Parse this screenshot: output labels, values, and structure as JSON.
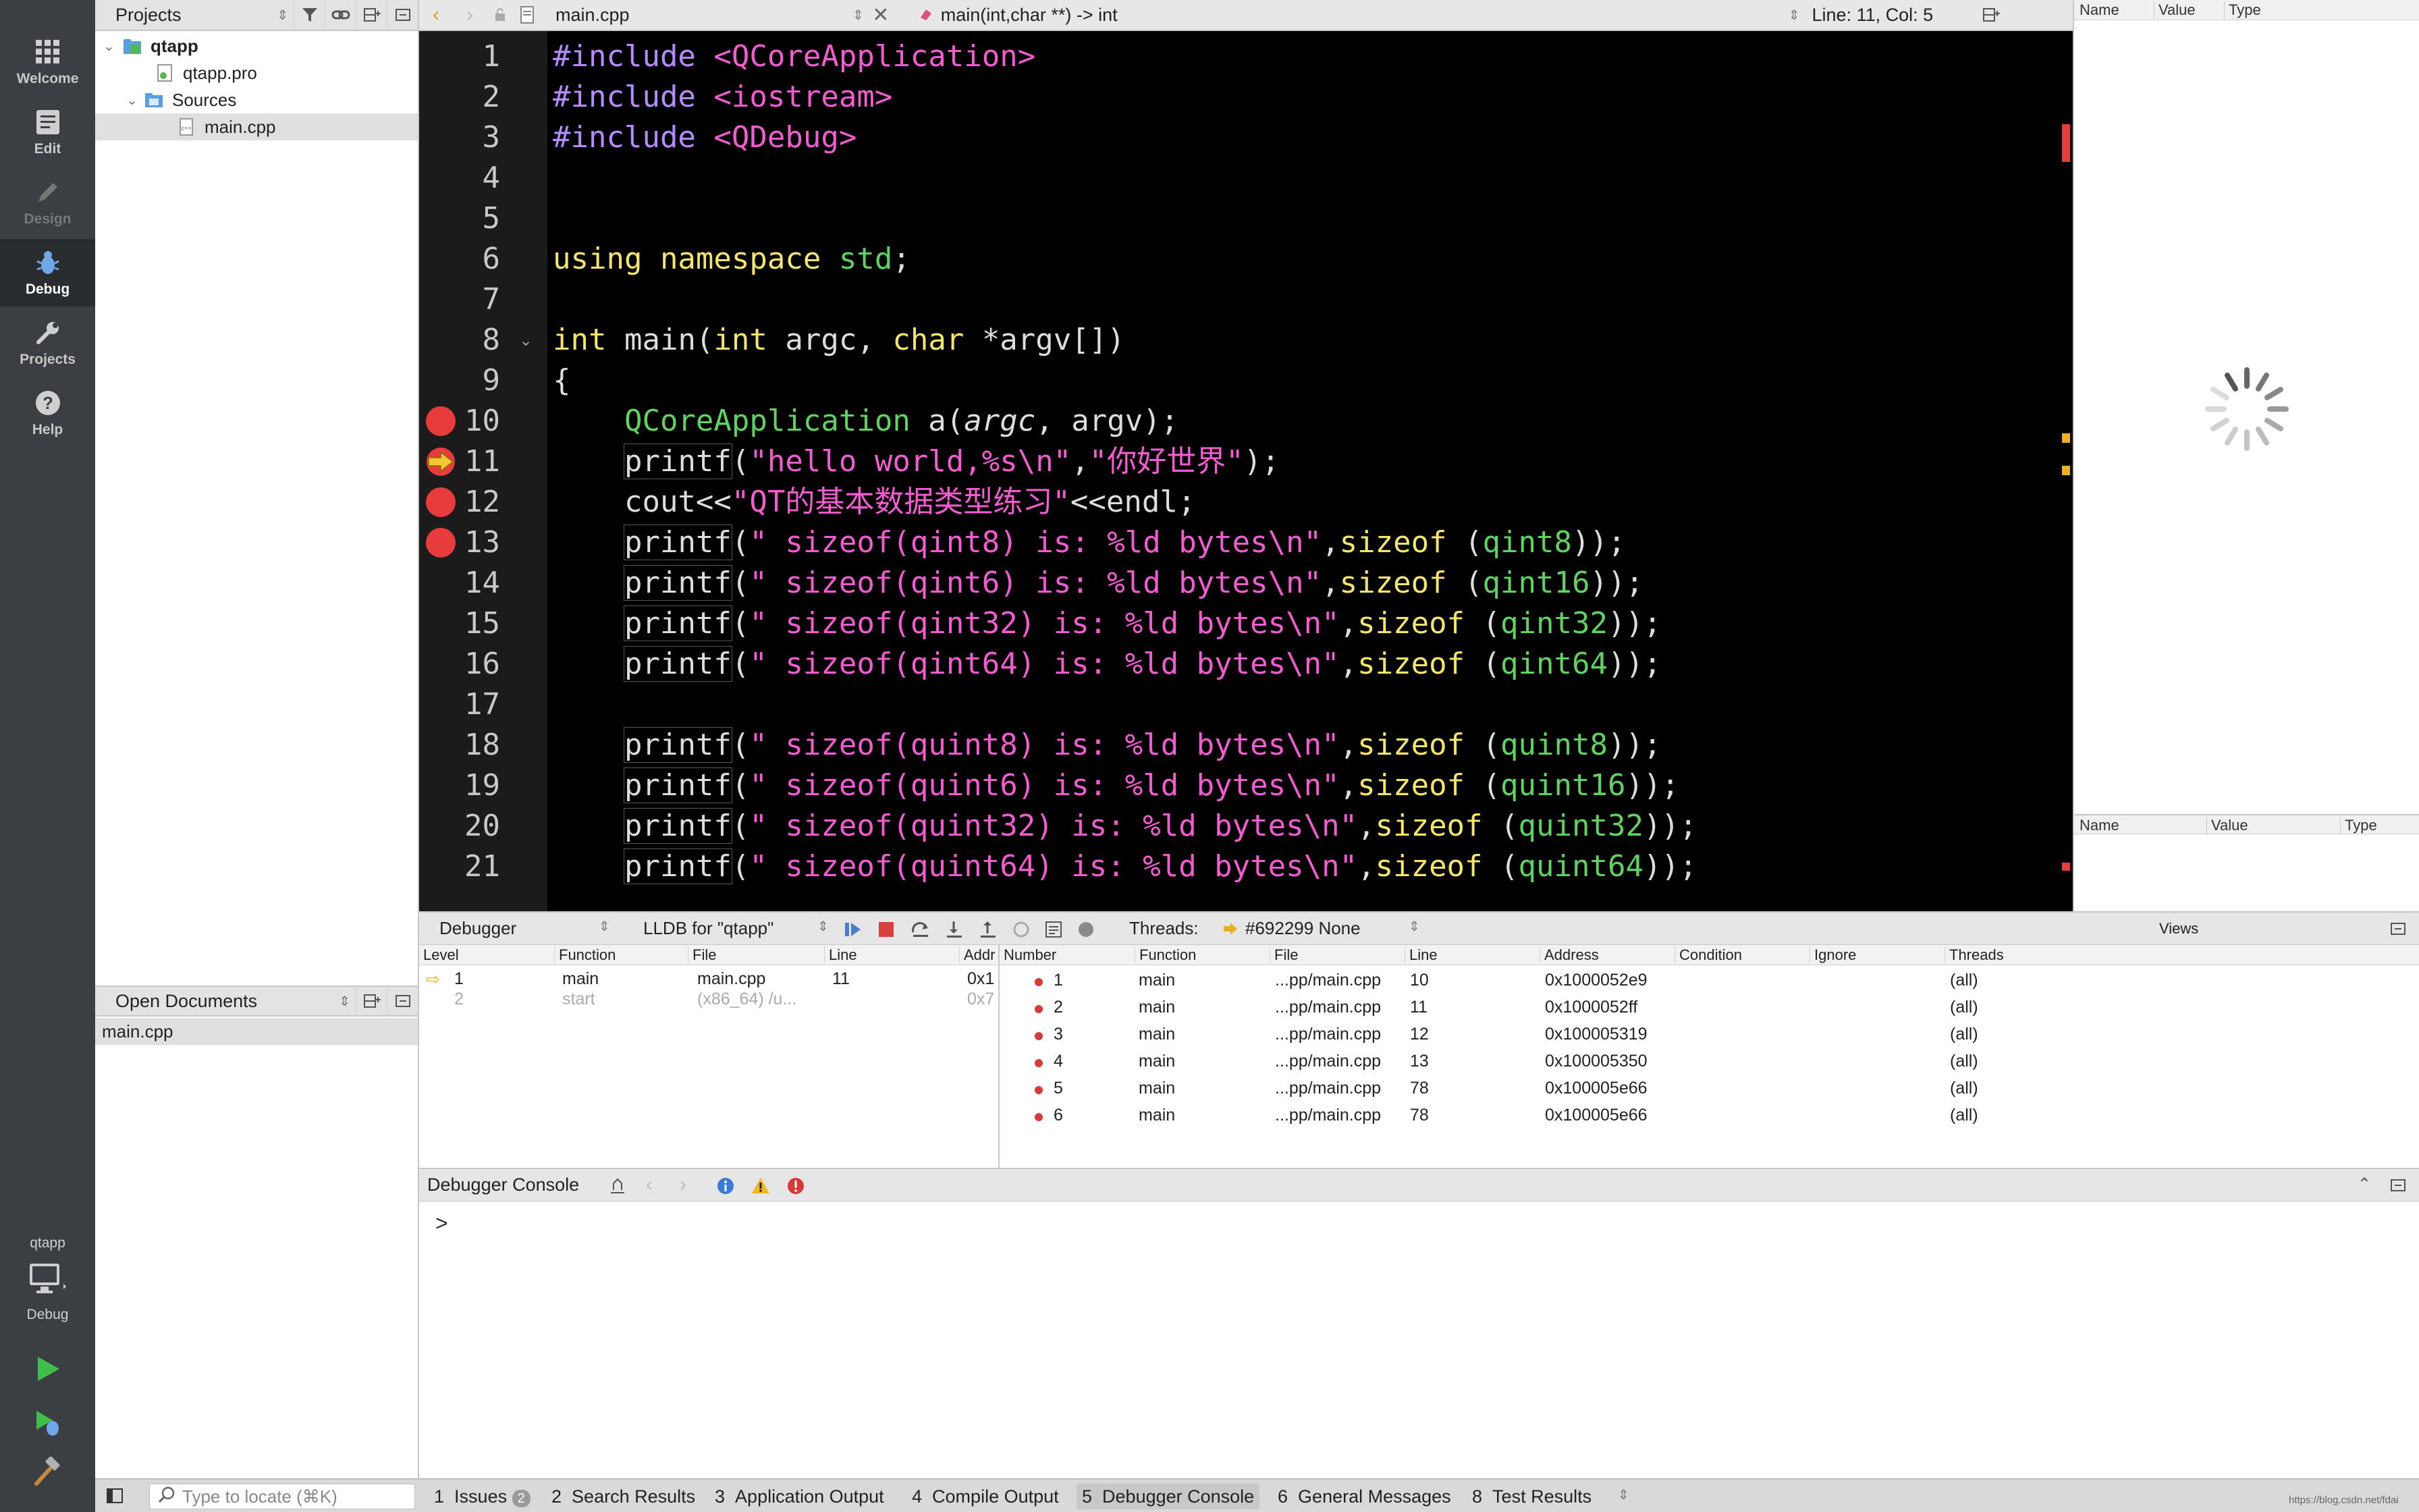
{
  "modes": [
    {
      "label": "Welcome",
      "icon": "grid-icon"
    },
    {
      "label": "Edit",
      "icon": "edit-icon"
    },
    {
      "label": "Design",
      "icon": "pencil-icon"
    },
    {
      "label": "Debug",
      "icon": "bug-icon"
    },
    {
      "label": "Projects",
      "icon": "wrench-icon"
    },
    {
      "label": "Help",
      "icon": "help-icon"
    }
  ],
  "kit": {
    "project": "qtapp",
    "build": "Debug"
  },
  "projects_panel": {
    "title": "Projects",
    "tree": {
      "project": "qtapp",
      "pro": "qtapp.pro",
      "sources": "Sources",
      "file": "main.cpp"
    }
  },
  "open_documents": {
    "title": "Open Documents",
    "items": [
      "main.cpp"
    ]
  },
  "editor_toolbar": {
    "file": "main.cpp",
    "symbol": "main(int,char **) -> int",
    "position": "Line: 11, Col: 5"
  },
  "code": {
    "line_numbers": [
      "1",
      "2",
      "3",
      "4",
      "5",
      "6",
      "7",
      "8",
      "9",
      "10",
      "11",
      "12",
      "13",
      "14",
      "15",
      "16",
      "17",
      "18",
      "19",
      "20",
      "21"
    ],
    "breakpoint_lines": [
      10,
      12,
      13
    ],
    "current_line": 11,
    "lines": {
      "l1a": "#include",
      "l1b": " <QCoreApplication>",
      "l2a": "#include",
      "l2b": " <iostream>",
      "l3a": "#include",
      "l3b": " <QDebug>",
      "l6a": "using namespace",
      "l6b": " std",
      "l6c": ";",
      "l8a": "int",
      "l8b": " main(",
      "l8c": "int",
      "l8d": " argc, ",
      "l8e": "char",
      "l8f": " *argv[])",
      "l9": "{",
      "l10a": "    ",
      "l10b": "QCoreApplication",
      "l10c": " a(",
      "l10d": "argc",
      "l10e": ", argv);",
      "l11a": "    ",
      "l11b": "printf",
      "l11c": "(",
      "l11d": "\"hello world,%s\\n\"",
      "l11e": ",",
      "l11f": "\"你好世界\"",
      "l11g": ");",
      "l12a": "    cout<<",
      "l12b": "\"QT的基本数据类型练习\"",
      "l12c": "<<endl;",
      "l13a": "    ",
      "l13b": "printf",
      "l13c": "(",
      "l13d": "\" sizeof(qint8) is: %ld bytes\\n\"",
      "l13e": ",",
      "l13f": "sizeof",
      "l13g": " (",
      "l13h": "qint8",
      "l13i": "));",
      "l14a": "    ",
      "l14b": "printf",
      "l14c": "(",
      "l14d": "\" sizeof(qint6) is: %ld bytes\\n\"",
      "l14e": ",",
      "l14f": "sizeof",
      "l14g": " (",
      "l14h": "qint16",
      "l14i": "));",
      "l15a": "    ",
      "l15b": "printf",
      "l15c": "(",
      "l15d": "\" sizeof(qint32) is: %ld bytes\\n\"",
      "l15e": ",",
      "l15f": "sizeof",
      "l15g": " (",
      "l15h": "qint32",
      "l15i": "));",
      "l16a": "    ",
      "l16b": "printf",
      "l16c": "(",
      "l16d": "\" sizeof(qint64) is: %ld bytes\\n\"",
      "l16e": ",",
      "l16f": "sizeof",
      "l16g": " (",
      "l16h": "qint64",
      "l16i": "));",
      "l18a": "    ",
      "l18b": "printf",
      "l18c": "(",
      "l18d": "\" sizeof(quint8) is: %ld bytes\\n\"",
      "l18e": ",",
      "l18f": "sizeof",
      "l18g": " (",
      "l18h": "quint8",
      "l18i": "));",
      "l19a": "    ",
      "l19b": "printf",
      "l19c": "(",
      "l19d": "\" sizeof(quint6) is: %ld bytes\\n\"",
      "l19e": ",",
      "l19f": "sizeof",
      "l19g": " (",
      "l19h": "quint16",
      "l19i": "));",
      "l20a": "    ",
      "l20b": "printf",
      "l20c": "(",
      "l20d": "\" sizeof(quint32) is: %ld bytes\\n\"",
      "l20e": ",",
      "l20f": "sizeof",
      "l20g": " (",
      "l20h": "quint32",
      "l20i": "));",
      "l21a": "    ",
      "l21b": "printf",
      "l21c": "(",
      "l21d": "\" sizeof(quint64) is: %ld bytes\\n\"",
      "l21e": ",",
      "l21f": "sizeof",
      "l21g": " (",
      "l21h": "quint64",
      "l21i": "));"
    }
  },
  "locals": {
    "columns": [
      "Name",
      "Value",
      "Type"
    ],
    "columns2": [
      "Name",
      "Value",
      "Type"
    ]
  },
  "debugger_toolbar": {
    "mode": "Debugger",
    "engine": "LLDB for \"qtapp\"",
    "threads_label": "Threads:",
    "thread": "#692299 None",
    "views": "Views"
  },
  "stack": {
    "columns": [
      "Level",
      "Function",
      "File",
      "Line",
      "Addr"
    ],
    "rows": [
      {
        "level": "1",
        "function": "main",
        "file": "main.cpp",
        "line": "11",
        "addr": "0x1"
      },
      {
        "level": "2",
        "function": "start",
        "file": "(x86_64) /u...",
        "line": "",
        "addr": "0x7"
      }
    ]
  },
  "breakpoints": {
    "columns": [
      "Number",
      "Function",
      "File",
      "Line",
      "Address",
      "Condition",
      "Ignore",
      "Threads"
    ],
    "rows": [
      {
        "number": "1",
        "function": "main",
        "file": "...pp/main.cpp",
        "line": "10",
        "address": "0x1000052e9",
        "threads": "(all)"
      },
      {
        "number": "2",
        "function": "main",
        "file": "...pp/main.cpp",
        "line": "11",
        "address": "0x1000052ff",
        "threads": "(all)"
      },
      {
        "number": "3",
        "function": "main",
        "file": "...pp/main.cpp",
        "line": "12",
        "address": "0x100005319",
        "threads": "(all)"
      },
      {
        "number": "4",
        "function": "main",
        "file": "...pp/main.cpp",
        "line": "13",
        "address": "0x100005350",
        "threads": "(all)"
      },
      {
        "number": "5",
        "function": "main",
        "file": "...pp/main.cpp",
        "line": "78",
        "address": "0x100005e66",
        "threads": "(all)"
      },
      {
        "number": "6",
        "function": "main",
        "file": "...pp/main.cpp",
        "line": "78",
        "address": "0x100005e66",
        "threads": "(all)"
      }
    ]
  },
  "console": {
    "title": "Debugger Console",
    "prompt": ">"
  },
  "statusbar": {
    "locate_placeholder": "Type to locate (⌘K)",
    "tabs": [
      {
        "num": "1",
        "label": "Issues",
        "badge": "2"
      },
      {
        "num": "2",
        "label": "Search Results"
      },
      {
        "num": "3",
        "label": "Application Output"
      },
      {
        "num": "4",
        "label": "Compile Output"
      },
      {
        "num": "5",
        "label": "Debugger Console"
      },
      {
        "num": "6",
        "label": "General Messages"
      },
      {
        "num": "8",
        "label": "Test Results"
      }
    ],
    "watermark": "https://blog.csdn.net/fdai"
  },
  "colors": {
    "keyword": "#f5e66a",
    "preprocessor": "#b48cff",
    "string": "#f25cd0",
    "type": "#5fd35f",
    "breakpoint": "#e83b3b",
    "editor_bg": "#000000",
    "sidebar_bg": "#3b3f43"
  }
}
